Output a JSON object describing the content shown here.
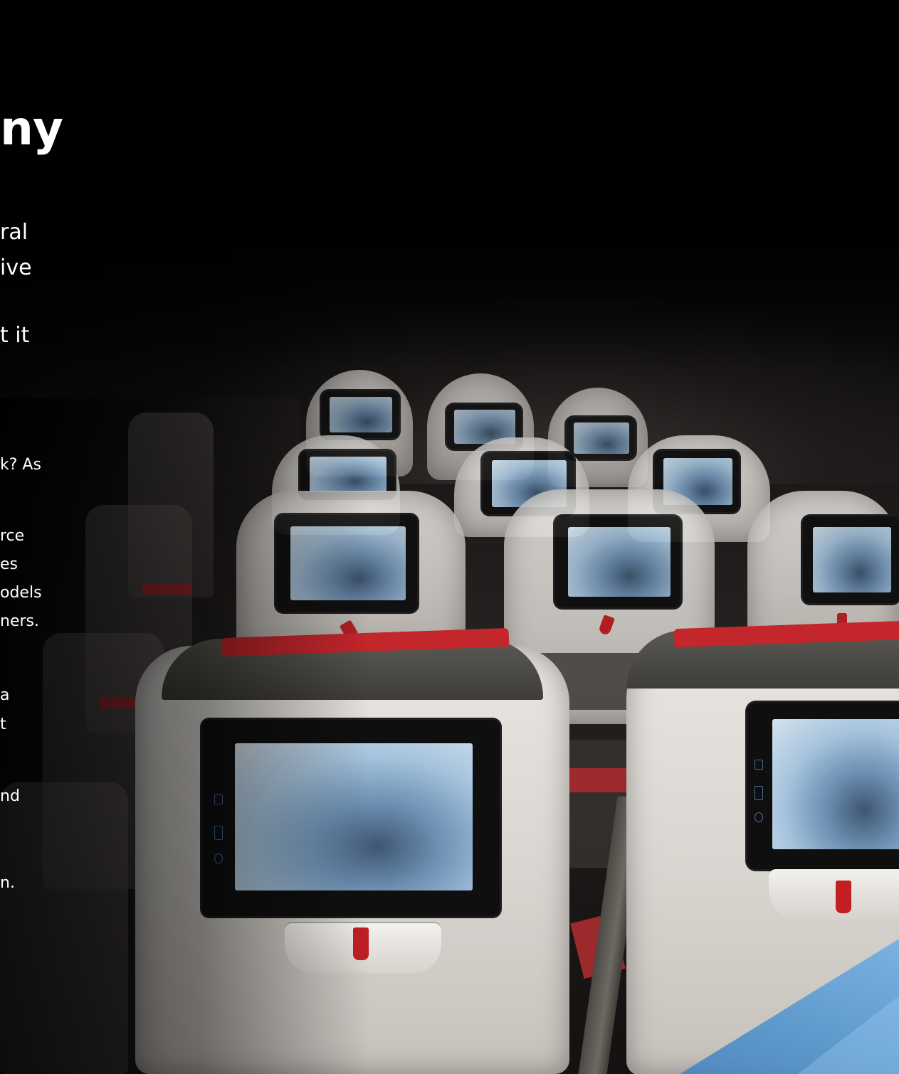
{
  "heading": {
    "fragment": "ny"
  },
  "lead_paragraph": {
    "lines": [
      "ral",
      "ive",
      "t it"
    ]
  },
  "body_paragraphs": {
    "lines": [
      "k? As",
      "rce",
      "es",
      "odels",
      "ners.",
      "a",
      "t",
      "nd",
      "n."
    ]
  },
  "background": {
    "description_icon": "airplane-cabin-photo",
    "accent_red": "#c3262b",
    "screen_blue": "#6d90b3",
    "triangle_blue": "#6aa6da"
  }
}
